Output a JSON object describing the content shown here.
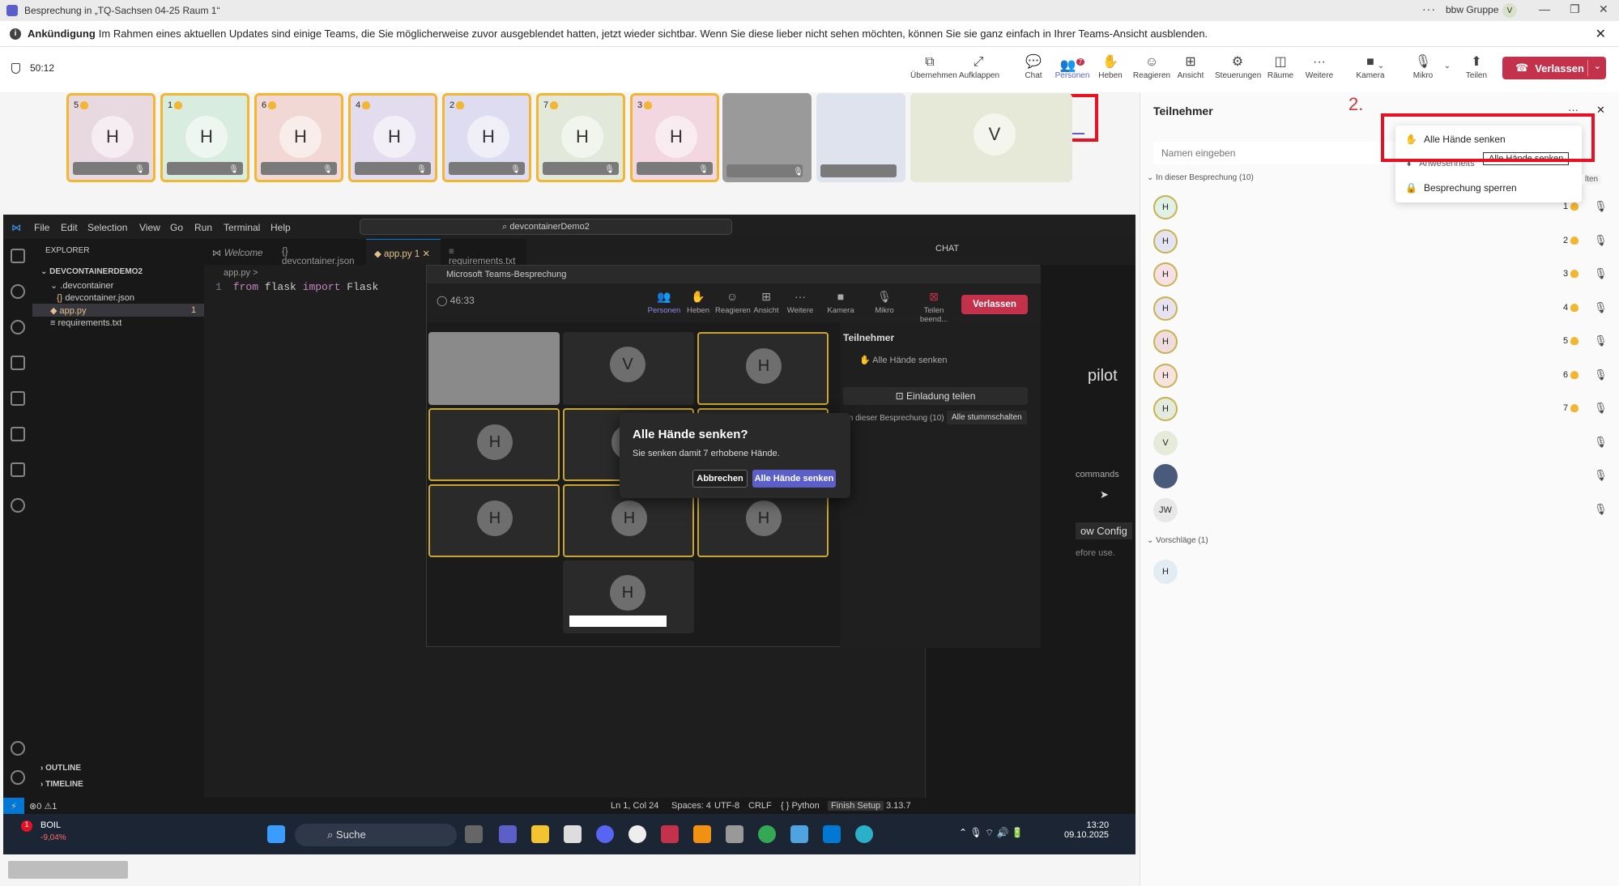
{
  "window": {
    "title": "Besprechung in „TQ-Sachsen 04-25 Raum 1“",
    "org": "bbw Gruppe",
    "avatar": "V"
  },
  "announcement": {
    "label": "Ankündigung",
    "text": "Im Rahmen eines aktuellen Updates sind einige Teams, die Sie möglicherweise zuvor ausgeblendet hatten, jetzt wieder sichtbar. Wenn Sie diese lieber nicht sehen möchten, können Sie sie ganz einfach in Ihrer Teams-Ansicht ausblenden."
  },
  "meeting": {
    "timer": "50:12"
  },
  "toolbar": [
    {
      "label": "Übernehmen",
      "icon": "share-screen-icon"
    },
    {
      "label": "Aufklappen",
      "icon": "expand-icon"
    },
    {
      "label": "Chat",
      "icon": "chat-icon"
    },
    {
      "label": "Personen",
      "icon": "people-icon",
      "badge": "7"
    },
    {
      "label": "Heben",
      "icon": "raise-hand-icon"
    },
    {
      "label": "Reagieren",
      "icon": "react-icon"
    },
    {
      "label": "Ansicht",
      "icon": "view-icon"
    },
    {
      "label": "Steuerungen",
      "icon": "controls-icon"
    },
    {
      "label": "Räume",
      "icon": "rooms-icon"
    },
    {
      "label": "Weitere",
      "icon": "more-icon"
    },
    {
      "label": "Kamera",
      "icon": "camera-off-icon"
    },
    {
      "label": "Mikro",
      "icon": "mic-icon"
    },
    {
      "label": "Teilen",
      "icon": "share-icon"
    }
  ],
  "leave_label": "Verlassen",
  "tiles": [
    {
      "num": "5",
      "initial": "H",
      "bg": "#e8d8df"
    },
    {
      "num": "1",
      "initial": "H",
      "bg": "#d8ecdf"
    },
    {
      "num": "6",
      "initial": "H",
      "bg": "#f2d8d4"
    },
    {
      "num": "4",
      "initial": "H",
      "bg": "#e2dcee"
    },
    {
      "num": "2",
      "initial": "H",
      "bg": "#dddcf0"
    },
    {
      "num": "7",
      "initial": "H",
      "bg": "#e2e8da"
    },
    {
      "num": "3",
      "initial": "H",
      "bg": "#f2d6e0"
    },
    {
      "num": "",
      "initial": "",
      "bg": "#9a9a9a"
    },
    {
      "num": "",
      "initial": "",
      "bg": "#dfe3ee"
    },
    {
      "num": "",
      "initial": "V",
      "bg": "#e6e9d8"
    }
  ],
  "panel": {
    "title": "Teilnehmer",
    "search_placeholder": "Namen eingeben",
    "in_meeting": "In dieser Besprechung (10)",
    "suggestions": "Vorschläge (1)",
    "step": "2.",
    "rows": [
      {
        "initial": "H",
        "num": "1",
        "bg": "#dff0e4"
      },
      {
        "initial": "H",
        "num": "2",
        "bg": "#e4e3f2"
      },
      {
        "initial": "H",
        "num": "3",
        "bg": "#f7dfe6"
      },
      {
        "initial": "H",
        "num": "4",
        "bg": "#e6e2f0"
      },
      {
        "initial": "H",
        "num": "5",
        "bg": "#efdcdc"
      },
      {
        "initial": "H",
        "num": "6",
        "bg": "#f6e2df"
      },
      {
        "initial": "H",
        "num": "7",
        "bg": "#e3ebdd"
      },
      {
        "initial": "V",
        "num": "",
        "bg": "#e6ead8"
      },
      {
        "initial": "",
        "num": "",
        "bg": "#4a5a7a"
      },
      {
        "initial": "JW",
        "num": "",
        "bg": "#e8e8e8"
      }
    ],
    "suggestion_initial": "H",
    "menu": {
      "lower_all": "Alle Hände senken",
      "attendance": "Anwesenheits",
      "tooltip": "Alle Hände senken",
      "lock": "Besprechung sperren",
      "partial": "lten"
    }
  },
  "vscode": {
    "menu": [
      "File",
      "Edit",
      "Selection",
      "View",
      "Go",
      "Run",
      "Terminal",
      "Help"
    ],
    "command": "devcontainerDemo2",
    "explorer": "EXPLORER",
    "project": "DEVCONTAINERDEMO2",
    "folder": ".devcontainer",
    "file1": "devcontainer.json",
    "file2": "app.py",
    "file2_badge": "1",
    "file3": "requirements.txt",
    "outline": "OUTLINE",
    "timeline": "TIMELINE",
    "tabs": [
      "Welcome",
      "devcontainer.json",
      "app.py",
      "requirements.txt"
    ],
    "tab_badge": "1",
    "breadcrumb": "app.py >",
    "line_no": "1",
    "code": "from flask import Flask",
    "chat_tab": "CHAT",
    "chat_text": "pilot",
    "chat_commands": "commands",
    "chat_config": "ow Config",
    "chat_before": "efore use.",
    "status": {
      "errors": "⊗0 ⚠1",
      "pos": "Ln 1, Col 24",
      "spaces": "Spaces: 4",
      "enc": "UTF-8",
      "eol": "CRLF",
      "lang": "{ } Python",
      "setup": "Finish Setup",
      "ver": "3.13.7"
    }
  },
  "inner": {
    "title": "Microsoft Teams-Besprechung",
    "timer": "46:33",
    "tools": [
      "Personen",
      "Heben",
      "Reagieren",
      "Ansicht",
      "Weitere",
      "Kamera",
      "Mikro",
      "Teilen beend..."
    ],
    "badge": "7",
    "leave": "Verlassen",
    "panel_title": "Teilnehmer",
    "panel_lower": "Alle Hände senken",
    "invite": "Einladung teilen",
    "in_meeting": "In dieser Besprechung (10)",
    "mute_all": "Alle stummschalten",
    "dialog": {
      "title": "Alle Hände senken?",
      "desc": "Sie senken damit 7 erhobene Hände.",
      "cancel": "Abbrechen",
      "confirm": "Alle Hände senken"
    }
  },
  "taskbar": {
    "weather": "BOIL",
    "weather_sub": "-9,04%",
    "search": "Suche",
    "time": "13:20",
    "date": "09.10.2025"
  }
}
